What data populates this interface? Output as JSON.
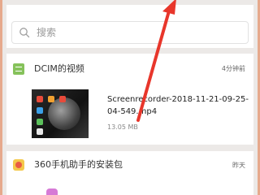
{
  "search": {
    "placeholder": "搜索"
  },
  "groups": [
    {
      "title": "DCIM的视频",
      "time": "4分钟前",
      "files": [
        {
          "name": "Screenrecorder-2018-11-21-09-25-04-549.mp4",
          "size": "13.05 MB"
        }
      ]
    },
    {
      "title": "360手机助手的安装包",
      "time": "昨天"
    }
  ],
  "colors": {
    "accent_arrow": "#e8362b",
    "folder_icon": "#86c25b",
    "frame_border": "#e6a98c"
  },
  "icons": {
    "search": "search-icon",
    "video_folder": "video-folder-icon",
    "app_package": "app-package-icon"
  }
}
